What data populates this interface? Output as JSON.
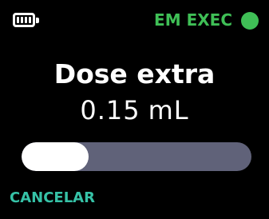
{
  "status": {
    "label": "EM EXEC",
    "color": "#3fbf56"
  },
  "battery": {
    "level": 1.0
  },
  "main": {
    "title": "Dose extra",
    "amount": "0.15",
    "unit": "mL"
  },
  "progress": {
    "fraction": 0.29,
    "track_color": "#606279",
    "fill_color": "#ffffff"
  },
  "actions": {
    "cancel_label": "CANCELAR",
    "cancel_color": "#36c2a7"
  }
}
